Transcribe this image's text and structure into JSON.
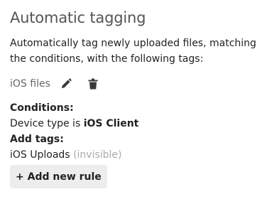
{
  "section": {
    "title": "Automatic tagging",
    "description": "Automatically tag newly uploaded files, matching the conditions, with the following tags:"
  },
  "rule": {
    "name": "iOS files",
    "conditions_heading": "Conditions:",
    "condition_prefix": "Device type is ",
    "condition_value": "iOS Client",
    "tags_heading": "Add tags:",
    "tag_name": "iOS Uploads",
    "tag_visibility": "(invisible)",
    "edit_icon": "pencil-icon",
    "delete_icon": "trash-icon"
  },
  "add_rule_button": {
    "label": "+ Add new rule"
  },
  "colors": {
    "title": "#555555",
    "text": "#222222",
    "muted": "#aaaaaa",
    "button_bg": "#ededed",
    "icon": "#3a3a3a"
  }
}
